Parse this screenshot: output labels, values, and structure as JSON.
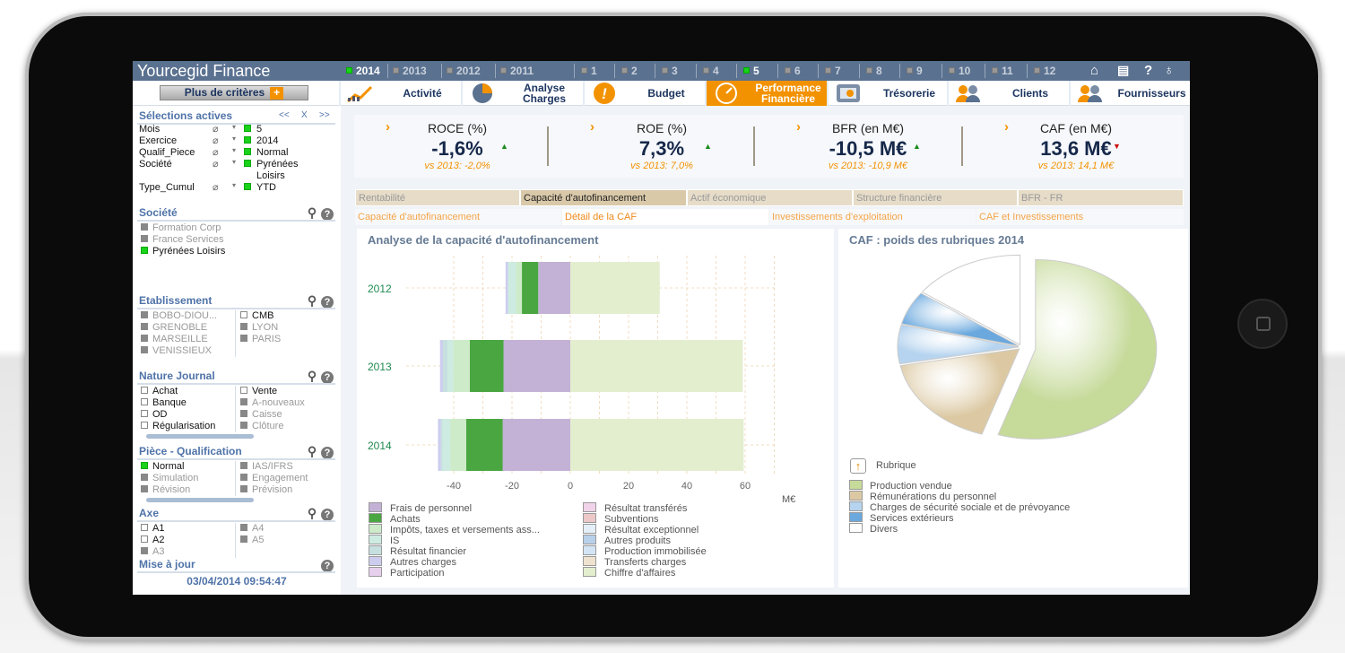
{
  "app": {
    "title": "Yourcegid Finance"
  },
  "years": [
    {
      "label": "2014",
      "selected": true
    },
    {
      "label": "2013",
      "selected": false
    },
    {
      "label": "2012",
      "selected": false
    },
    {
      "label": "2011",
      "selected": false
    }
  ],
  "months": [
    {
      "label": "1",
      "selected": false
    },
    {
      "label": "2",
      "selected": false
    },
    {
      "label": "3",
      "selected": false
    },
    {
      "label": "4",
      "selected": false
    },
    {
      "label": "5",
      "selected": true
    },
    {
      "label": "6",
      "selected": false
    },
    {
      "label": "7",
      "selected": false
    },
    {
      "label": "8",
      "selected": false
    },
    {
      "label": "9",
      "selected": false
    },
    {
      "label": "10",
      "selected": false
    },
    {
      "label": "11",
      "selected": false
    },
    {
      "label": "12",
      "selected": false
    }
  ],
  "toolbar_icons": [
    "home-icon",
    "document-icon",
    "help-icon",
    "lightbulb-icon"
  ],
  "plus_criteres": "Plus de critères",
  "nav": [
    {
      "label": "Activité",
      "icon": "growth-chart-icon"
    },
    {
      "label": "Analyse Charges",
      "icon": "pie-chart-icon"
    },
    {
      "label": "Budget",
      "icon": "warning-icon"
    },
    {
      "label": "Performance Financière",
      "icon": "gauge-icon",
      "active": true
    },
    {
      "label": "Trésorerie",
      "icon": "safe-icon"
    },
    {
      "label": "Clients",
      "icon": "users-icon"
    },
    {
      "label": "Fournisseurs",
      "icon": "suppliers-icon"
    }
  ],
  "selections": {
    "title": "Sélections actives",
    "prev": "<<",
    "clear": "X",
    "next": ">>",
    "items": [
      {
        "field": "Mois",
        "value": "5"
      },
      {
        "field": "Exercice",
        "value": "2014"
      },
      {
        "field": "Qualif_Piece",
        "value": "Normal"
      },
      {
        "field": "Société",
        "value": "Pyrénées Loisirs"
      },
      {
        "field": "Type_Cumul",
        "value": "YTD"
      }
    ]
  },
  "filters": {
    "societe": {
      "title": "Société",
      "items": [
        {
          "label": "Formation Corp",
          "state": "grey"
        },
        {
          "label": "France Services",
          "state": "grey"
        },
        {
          "label": "Pyrénées Loisirs",
          "state": "selected"
        }
      ]
    },
    "etablissement": {
      "title": "Etablissement",
      "col1": [
        {
          "label": "BOBO-DIOU...",
          "state": "grey"
        },
        {
          "label": "GRENOBLE",
          "state": "grey"
        },
        {
          "label": "MARSEILLE",
          "state": "grey"
        },
        {
          "label": "VENISSIEUX",
          "state": "grey"
        }
      ],
      "col2": [
        {
          "label": "CMB",
          "state": "open"
        },
        {
          "label": "LYON",
          "state": "grey"
        },
        {
          "label": "PARIS",
          "state": "grey"
        }
      ]
    },
    "nature": {
      "title": "Nature Journal",
      "col1": [
        {
          "label": "Achat",
          "state": "open"
        },
        {
          "label": "Banque",
          "state": "open"
        },
        {
          "label": "OD",
          "state": "open"
        },
        {
          "label": "Régularisation",
          "state": "open"
        }
      ],
      "col2": [
        {
          "label": "Vente",
          "state": "open"
        },
        {
          "label": "A-nouveaux",
          "state": "grey"
        },
        {
          "label": "Caisse",
          "state": "grey"
        },
        {
          "label": "Clôture",
          "state": "grey"
        }
      ]
    },
    "piece": {
      "title": "Pièce - Qualification",
      "col1": [
        {
          "label": "Normal",
          "state": "selected"
        },
        {
          "label": "Simulation",
          "state": "grey"
        },
        {
          "label": "Révision",
          "state": "grey"
        }
      ],
      "col2": [
        {
          "label": "IAS/IFRS",
          "state": "grey"
        },
        {
          "label": "Engagement",
          "state": "grey"
        },
        {
          "label": "Prévision",
          "state": "grey"
        }
      ]
    },
    "axe": {
      "title": "Axe",
      "col1": [
        {
          "label": "A1",
          "state": "open"
        },
        {
          "label": "A2",
          "state": "open"
        },
        {
          "label": "A3",
          "state": "grey"
        }
      ],
      "col2": [
        {
          "label": "A4",
          "state": "grey"
        },
        {
          "label": "A5",
          "state": "grey"
        }
      ]
    }
  },
  "update": {
    "title": "Mise à jour",
    "value": "03/04/2014 09:54:47"
  },
  "kpis": [
    {
      "title": "ROCE (%)",
      "value": "-1,6%",
      "trend": "up",
      "compare": "vs 2013: -2,0%"
    },
    {
      "title": "ROE (%)",
      "value": "7,3%",
      "trend": "up",
      "compare": "vs 2013: 7,0%"
    },
    {
      "title": "BFR (en M€)",
      "value": "-10,5 M€",
      "trend": "up",
      "compare": "vs 2013: -10,9 M€"
    },
    {
      "title": "CAF (en M€)",
      "value": "13,6 M€",
      "trend": "down",
      "compare": "vs 2013: 14,1 M€"
    }
  ],
  "colors": {
    "up": "#1a8a1a",
    "down": "#cc1111",
    "accent": "#f39200"
  },
  "tabs": [
    {
      "label": "Rentabilité"
    },
    {
      "label": "Capacité d'autofinancement",
      "active": true
    },
    {
      "label": "Actif économique"
    },
    {
      "label": "Structure financière"
    },
    {
      "label": "BFR - FR"
    }
  ],
  "subtabs": [
    {
      "label": "Capacité d'autofinancement"
    },
    {
      "label": "Détail de la CAF",
      "active": true
    },
    {
      "label": "Investissements d'exploitation"
    },
    {
      "label": "CAF et Investissements"
    }
  ],
  "chart_data": [
    {
      "type": "bar",
      "orientation": "horizontal",
      "stacked": true,
      "title": "Analyse de la capacité d'autofinancement",
      "xlabel": "M€",
      "categories": [
        "2012",
        "2013",
        "2014"
      ],
      "xlim": [
        -45,
        70
      ],
      "xticks": [
        -40,
        -20,
        0,
        20,
        40,
        60
      ],
      "grid": true,
      "legend": "bottom",
      "series": [
        {
          "name": "Frais de personnel",
          "color": "#c3b1d6",
          "values": [
            -11.0,
            -22.9,
            -23.2
          ]
        },
        {
          "name": "Achats",
          "color": "#4aa640",
          "values": [
            -5.6,
            -11.6,
            -12.5
          ]
        },
        {
          "name": "Impôts, taxes et versements ass...",
          "color": "#cdebc9",
          "values": [
            -2.0,
            -5.6,
            -5.5
          ]
        },
        {
          "name": "IS",
          "color": "#cdebe0",
          "values": [
            -2.8,
            -2.0,
            -2.6
          ]
        },
        {
          "name": "Résultat financier",
          "color": "#c6e0df",
          "values": [
            0,
            -1.6,
            -0.6
          ]
        },
        {
          "name": "Autres charges",
          "color": "#cccdee",
          "values": [
            -0.8,
            -1.0,
            -1.0
          ]
        },
        {
          "name": "Participation",
          "color": "#e6d0ee",
          "values": [
            0,
            0,
            0
          ]
        },
        {
          "name": "Résultat transférés",
          "color": "#f0d3e8",
          "values": [
            0,
            0,
            0
          ]
        },
        {
          "name": "Subventions",
          "color": "#ecc8c8",
          "values": [
            0,
            0,
            0
          ]
        },
        {
          "name": "Résultat exceptionnel",
          "color": "#e4eff8",
          "values": [
            0,
            0,
            0
          ]
        },
        {
          "name": "Autres produits",
          "color": "#b8d0ea",
          "values": [
            0,
            0,
            0
          ]
        },
        {
          "name": "Production immobilisée",
          "color": "#d3e4f4",
          "values": [
            0,
            0,
            0
          ]
        },
        {
          "name": "Transferts charges",
          "color": "#efe3cf",
          "values": [
            0,
            0,
            0
          ]
        },
        {
          "name": "Chiffre d'affaires",
          "color": "#e3eecf",
          "values": [
            30.7,
            59.2,
            59.5
          ]
        }
      ]
    },
    {
      "type": "pie",
      "title": "CAF : poids des rubriques  2014",
      "legend_title": "Rubrique",
      "legend": "bottom",
      "slices": [
        {
          "name": "Production vendue",
          "value": 55,
          "color": "#c6da9a"
        },
        {
          "name": "Rémunérations du personnel",
          "value": 17,
          "color": "#dcc9a3"
        },
        {
          "name": "Charges de sécurité sociale et de prévoyance",
          "value": 7,
          "color": "#b6d4ef"
        },
        {
          "name": "Services extérieurs",
          "value": 6,
          "color": "#6aa8de"
        },
        {
          "name": "Divers",
          "value": 15,
          "color": "#ffffff"
        }
      ]
    }
  ]
}
